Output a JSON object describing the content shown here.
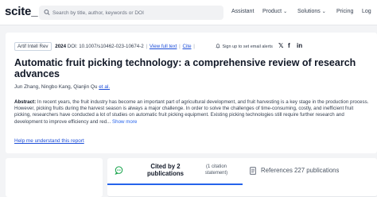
{
  "header": {
    "logo": "scite_",
    "search_placeholder": "Search by title, author, keywords or DOI",
    "nav": [
      {
        "label": "Assistant",
        "dropdown": false
      },
      {
        "label": "Product",
        "dropdown": true
      },
      {
        "label": "Solutions",
        "dropdown": true
      },
      {
        "label": "Pricing",
        "dropdown": false
      },
      {
        "label": "Log",
        "dropdown": false
      }
    ]
  },
  "paper": {
    "journal": "Artif Intell Rev",
    "year": "2024",
    "doi": "DOI: 10.1007/s10462-023-10674-2",
    "view_full_text": "View full text",
    "cite": "Cite",
    "alert_text": "Sign up to set email alerts",
    "social_icons": [
      "twitter-icon",
      "facebook-icon",
      "linkedin-icon"
    ],
    "title": "Automatic fruit picking technology: a comprehensive review of research advances",
    "authors": "Jun Zhang, Ningbo Kang, Qianjin Qu",
    "et_al": "et al.",
    "abstract_label": "Abstract:",
    "abstract_text": "In recent years, the fruit industry has become an important part of agricultural development, and fruit harvesting is a key stage in the production process. However, picking fruits during the harvest season is always a major challenge. In order to solve the challenges of time-consuming, costly, and inefficient fruit picking, researchers have conducted a lot of studies on automatic fruit picking equipment. Existing picking technologies still require further research and development to improve efficiency and red...",
    "show_more": "Show more",
    "help_link": "Help me understand this report"
  },
  "tabs": {
    "cited_by": "Cited by 2 publications",
    "cited_sub": "(1 citation statement)",
    "references": "References 227 publications"
  },
  "colors": {
    "link": "#1d4ed8",
    "accent": "#2563eb",
    "background": "#f3f4f6"
  }
}
